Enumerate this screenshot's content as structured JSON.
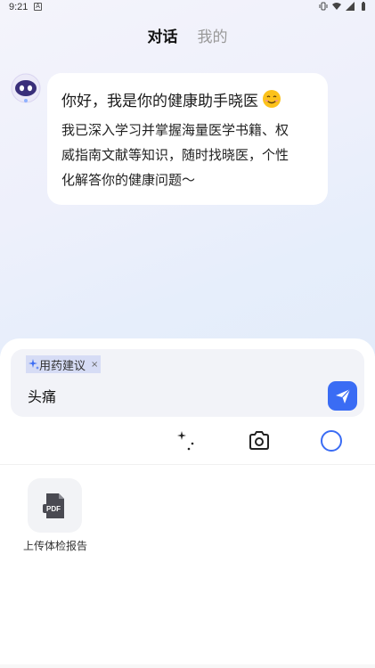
{
  "status_bar": {
    "time": "9:21",
    "notification_badge": "A"
  },
  "tabs": [
    {
      "label": "对话",
      "active": true
    },
    {
      "label": "我的",
      "active": false
    }
  ],
  "chat": {
    "greeting": "你好，我是你的健康助手晓医",
    "greeting_emoji": "smiling-face",
    "intro_lines": [
      "我已深入学习并掌握海量医学书籍、权",
      "威指南文献等知识，随时找晓医，个性",
      "化解答你的健康问题～"
    ]
  },
  "composer": {
    "chip_label": "用药建议",
    "chip_close": "×",
    "input_value": "头痛"
  },
  "toolbar": {
    "icons": [
      "sparkle-icon",
      "camera-icon",
      "voice-circle-icon"
    ]
  },
  "upload": {
    "icon_label": "PDF",
    "label": "上传体检报告"
  },
  "colors": {
    "accent": "#3a6cf4",
    "chip_bg": "#d6dcf5",
    "input_bg": "#f2f3f8"
  }
}
